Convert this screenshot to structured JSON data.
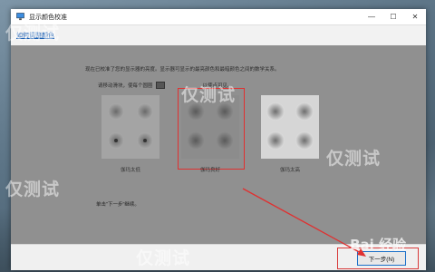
{
  "window": {
    "title": "显示颜色校准",
    "help_link": "如何调整颜色",
    "controls": {
      "minimize": "—",
      "maximize": "☐",
      "close": "✕"
    }
  },
  "main": {
    "description": "现在已校准了您的显示器的亮度。显示器可显示的最亮颜色和最暗颜色之间的数学关系。",
    "instruction_left": "请移动滑块，使每个圆圈",
    "instruction_right": "以使点可见。",
    "samples": [
      {
        "label": "伽玛太低"
      },
      {
        "label": "伽玛良好"
      },
      {
        "label": "伽玛太高"
      }
    ],
    "next_hint": "单击\"下一步\"继续。"
  },
  "footer": {
    "next_label": "下一步(N)"
  },
  "watermarks": [
    "仅测试",
    "仅测试",
    "仅测试",
    "仅测试",
    "仅测试"
  ],
  "baidu_logo": "Bai 经验",
  "colors": {
    "highlight": "#e03030",
    "link": "#1a5fb4",
    "accent": "#1a6fc8"
  }
}
